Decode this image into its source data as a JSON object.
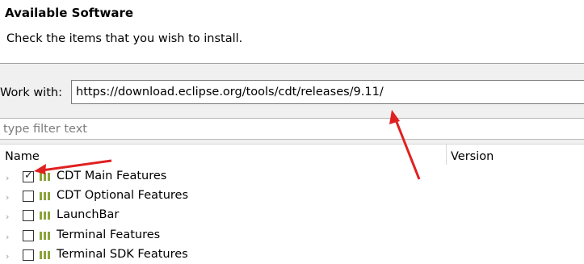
{
  "header": {
    "title": "Available Software",
    "subtitle": "Check the items that you wish to install."
  },
  "work_with": {
    "label": "Work with:",
    "value": "https://download.eclipse.org/tools/cdt/releases/9.11/"
  },
  "filter": {
    "placeholder": "type filter text"
  },
  "table": {
    "columns": [
      "Name",
      "Version"
    ],
    "rows": [
      {
        "label": "CDT Main Features",
        "checked": true
      },
      {
        "label": "CDT Optional Features",
        "checked": false
      },
      {
        "label": "LaunchBar",
        "checked": false
      },
      {
        "label": "Terminal Features",
        "checked": false
      },
      {
        "label": "Terminal SDK Features",
        "checked": false
      }
    ]
  },
  "icons": {
    "expander": "chevron-right-icon",
    "feature": "feature-group-icon",
    "annotation": "red-arrow"
  },
  "colors": {
    "annotation_arrow": "#e02020",
    "feature_icon": "#8aa43a"
  }
}
